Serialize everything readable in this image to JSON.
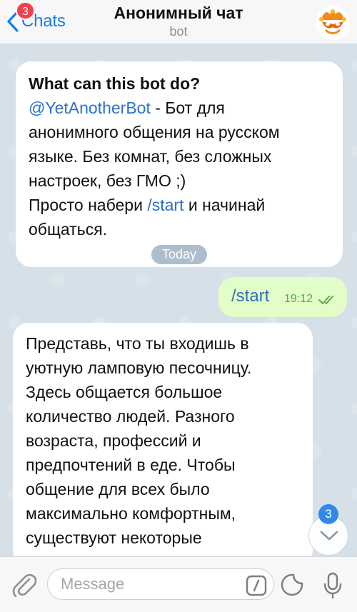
{
  "header": {
    "back_label": "Chats",
    "unread_badge": "3",
    "title": "Анонимный чат",
    "subtitle": "bot"
  },
  "bot_info": {
    "title": "What can this bot do?",
    "line1_link": "@YetAnotherBot",
    "line1_rest": " - Бот для",
    "line2": "анонимного общения на русском",
    "line3": "языке. Без комнат, без сложных",
    "line4": "настроек, без ГМО ;)",
    "line5_pre": "Просто набери ",
    "line5_link": "/start",
    "line5_post": " и начинай",
    "line6": "общаться."
  },
  "date_separator": "Today",
  "outgoing_message": {
    "text": "/start",
    "time": "19:12"
  },
  "incoming_message": {
    "lines": [
      "Представь, что ты входишь в",
      "уютную ламповую песочницу.",
      "Здесь общается большое",
      "количество людей. Разного",
      "возраста, профессий и",
      "предпочтений в еде. Чтобы",
      "общение для всех было",
      "максимально комфортным,",
      "существуют некоторые"
    ]
  },
  "scroll_badge": "3",
  "input": {
    "placeholder": "Message",
    "value": ""
  },
  "colors": {
    "accent": "#1a7de1",
    "badge_red": "#f0414d",
    "outgoing_bubble": "#e2fdc8",
    "chat_background": "#d6e0e8"
  },
  "icons": {
    "back": "chevron-left-icon",
    "attach": "paperclip-icon",
    "commands": "slash-command-icon",
    "sticker": "sticker-icon",
    "mic": "microphone-icon",
    "scroll": "chevron-down-icon",
    "read": "double-check-icon"
  }
}
